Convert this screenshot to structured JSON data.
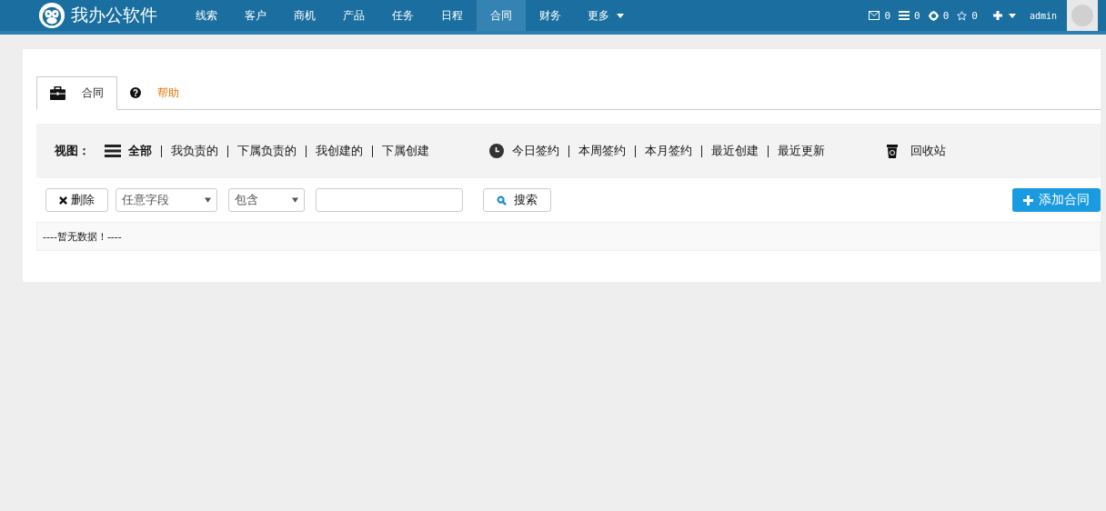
{
  "brand": {
    "name": "我办公软件"
  },
  "nav": [
    {
      "label": "线索",
      "selected": false
    },
    {
      "label": "客户",
      "selected": false
    },
    {
      "label": "商机",
      "selected": false
    },
    {
      "label": "产品",
      "selected": false
    },
    {
      "label": "任务",
      "selected": false
    },
    {
      "label": "日程",
      "selected": false
    },
    {
      "label": "合同",
      "selected": true
    },
    {
      "label": "财务",
      "selected": false
    },
    {
      "label": "更多",
      "selected": false,
      "dropdown": true
    }
  ],
  "counters": [
    {
      "kind": "mail",
      "count": "0"
    },
    {
      "kind": "list",
      "count": "0"
    },
    {
      "kind": "target",
      "count": "0"
    },
    {
      "kind": "star",
      "count": "0"
    }
  ],
  "user": {
    "name": "admin"
  },
  "tabs": [
    {
      "label": "合同",
      "kind": "briefcase",
      "selected": true
    },
    {
      "label": "帮助",
      "kind": "help",
      "selected": false
    }
  ],
  "views": {
    "label": "视图：",
    "items": [
      {
        "label": "全部",
        "selected": true
      },
      {
        "label": "我负责的",
        "selected": false
      },
      {
        "label": "下属负责的",
        "selected": false
      },
      {
        "label": "我创建的",
        "selected": false
      },
      {
        "label": "下属创建",
        "selected": false
      }
    ]
  },
  "time_filters": [
    {
      "label": "今日签约",
      "selected": false
    },
    {
      "label": "本周签约",
      "selected": false
    },
    {
      "label": "本月签约",
      "selected": false
    },
    {
      "label": "最近创建",
      "selected": false
    },
    {
      "label": "最近更新",
      "selected": false
    }
  ],
  "recycle": {
    "label": "回收站"
  },
  "toolbar": {
    "delete_button": "删除",
    "field_select": "任意字段",
    "operator_select": "包含",
    "search_button": "搜索",
    "add_button": "添加合同"
  },
  "empty_message": "----暂无数据！----"
}
